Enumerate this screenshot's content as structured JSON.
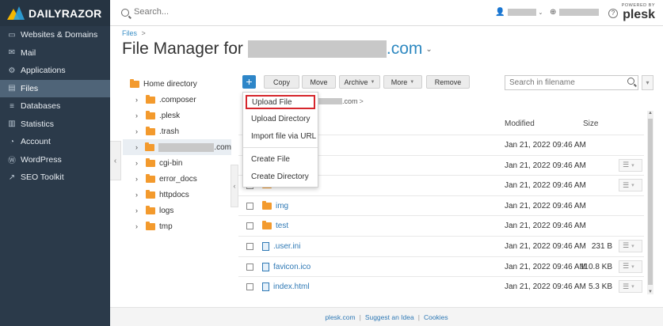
{
  "brand": {
    "name": "DAILYRAZOR"
  },
  "sidebar": {
    "items": [
      {
        "label": "Websites & Domains",
        "icon": "monitor-icon"
      },
      {
        "label": "Mail",
        "icon": "mail-icon"
      },
      {
        "label": "Applications",
        "icon": "gear-icon"
      },
      {
        "label": "Files",
        "icon": "files-icon",
        "active": true
      },
      {
        "label": "Databases",
        "icon": "database-icon"
      },
      {
        "label": "Statistics",
        "icon": "statistics-icon"
      },
      {
        "label": "Account",
        "icon": "account-icon"
      },
      {
        "label": "WordPress",
        "icon": "wordpress-icon"
      },
      {
        "label": "SEO Toolkit",
        "icon": "seo-icon"
      }
    ]
  },
  "header": {
    "search_placeholder": "Search...",
    "powered_by": "POWERED BY",
    "plesk_name": "plesk"
  },
  "breadcrumb": {
    "files": "Files",
    "sep": ">"
  },
  "page": {
    "title_prefix": "File Manager for",
    "domain_tail": ".com"
  },
  "tree": {
    "root": "Home directory",
    "items": [
      ".composer",
      ".plesk",
      ".trash",
      ".com",
      "cgi-bin",
      "error_docs",
      "httpdocs",
      "logs",
      "tmp"
    ]
  },
  "toolbar": {
    "add": "+",
    "copy": "Copy",
    "move": "Move",
    "archive": "Archive",
    "more": "More",
    "remove": "Remove",
    "filter_placeholder": "Search in filename"
  },
  "path": {
    "tail": ".com",
    "sep": ">"
  },
  "columns": {
    "modified": "Modified",
    "size": "Size"
  },
  "menu": {
    "upload_file": "Upload File",
    "upload_directory": "Upload Directory",
    "import_url": "Import file via URL",
    "create_file": "Create File",
    "create_directory": "Create Directory"
  },
  "files": [
    {
      "name": "",
      "type": "folder",
      "modified": "Jan 21, 2022 09:46 AM",
      "size": ""
    },
    {
      "name": "",
      "type": "folder",
      "modified": "Jan 21, 2022 09:46 AM",
      "size": ""
    },
    {
      "name": "",
      "type": "folder",
      "modified": "Jan 21, 2022 09:46 AM",
      "size": ""
    },
    {
      "name": "img",
      "type": "folder",
      "modified": "Jan 21, 2022 09:46 AM",
      "size": ""
    },
    {
      "name": "test",
      "type": "folder",
      "modified": "Jan 21, 2022 09:46 AM",
      "size": ""
    },
    {
      "name": ".user.ini",
      "type": "file",
      "modified": "Jan 21, 2022 09:46 AM",
      "size": "231 B"
    },
    {
      "name": "favicon.ico",
      "type": "file",
      "modified": "Jan 21, 2022 09:46 AM",
      "size": "110.8 KB"
    },
    {
      "name": "index.html",
      "type": "file",
      "modified": "Jan 21, 2022 09:46 AM",
      "size": "5.3 KB"
    }
  ],
  "footer": {
    "links": [
      "plesk.com",
      "Suggest an Idea",
      "Cookies"
    ]
  },
  "colors": {
    "sidebar_bg": "#2b3a4a",
    "accent": "#2e86c8",
    "folder": "#f39a2d",
    "highlight_border": "#d6262c"
  }
}
